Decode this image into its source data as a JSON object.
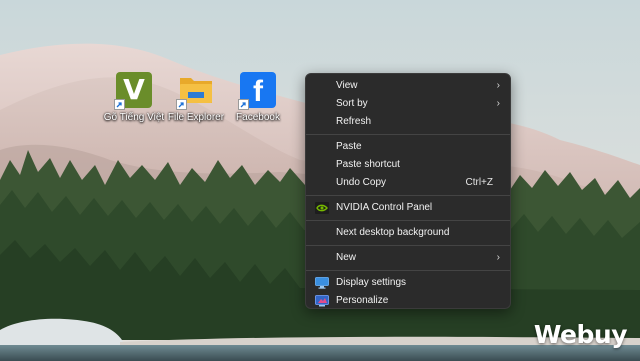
{
  "desktop": {
    "icons": [
      {
        "label": "Gõ Tiếng Việt",
        "glyph": "V",
        "icon": "gotiengviet-icon"
      },
      {
        "label": "File Explorer",
        "icon": "folder-icon"
      },
      {
        "label": "Facebook",
        "glyph": "f",
        "icon": "facebook-icon"
      }
    ]
  },
  "context_menu": {
    "view": "View",
    "sort_by": "Sort by",
    "refresh": "Refresh",
    "paste": "Paste",
    "paste_shortcut": "Paste shortcut",
    "undo_copy": "Undo Copy",
    "undo_shortcut_key": "Ctrl+Z",
    "nvidia": "NVIDIA Control Panel",
    "next_background": "Next desktop background",
    "new": "New",
    "display_settings": "Display settings",
    "personalize": "Personalize",
    "submenu_arrow": "›"
  },
  "watermark": "Webuy",
  "colors": {
    "menu_bg": "#2b2b2b",
    "nvidia_green": "#76b900",
    "facebook_blue": "#1877f2",
    "folder_yellow": "#f5c043"
  }
}
